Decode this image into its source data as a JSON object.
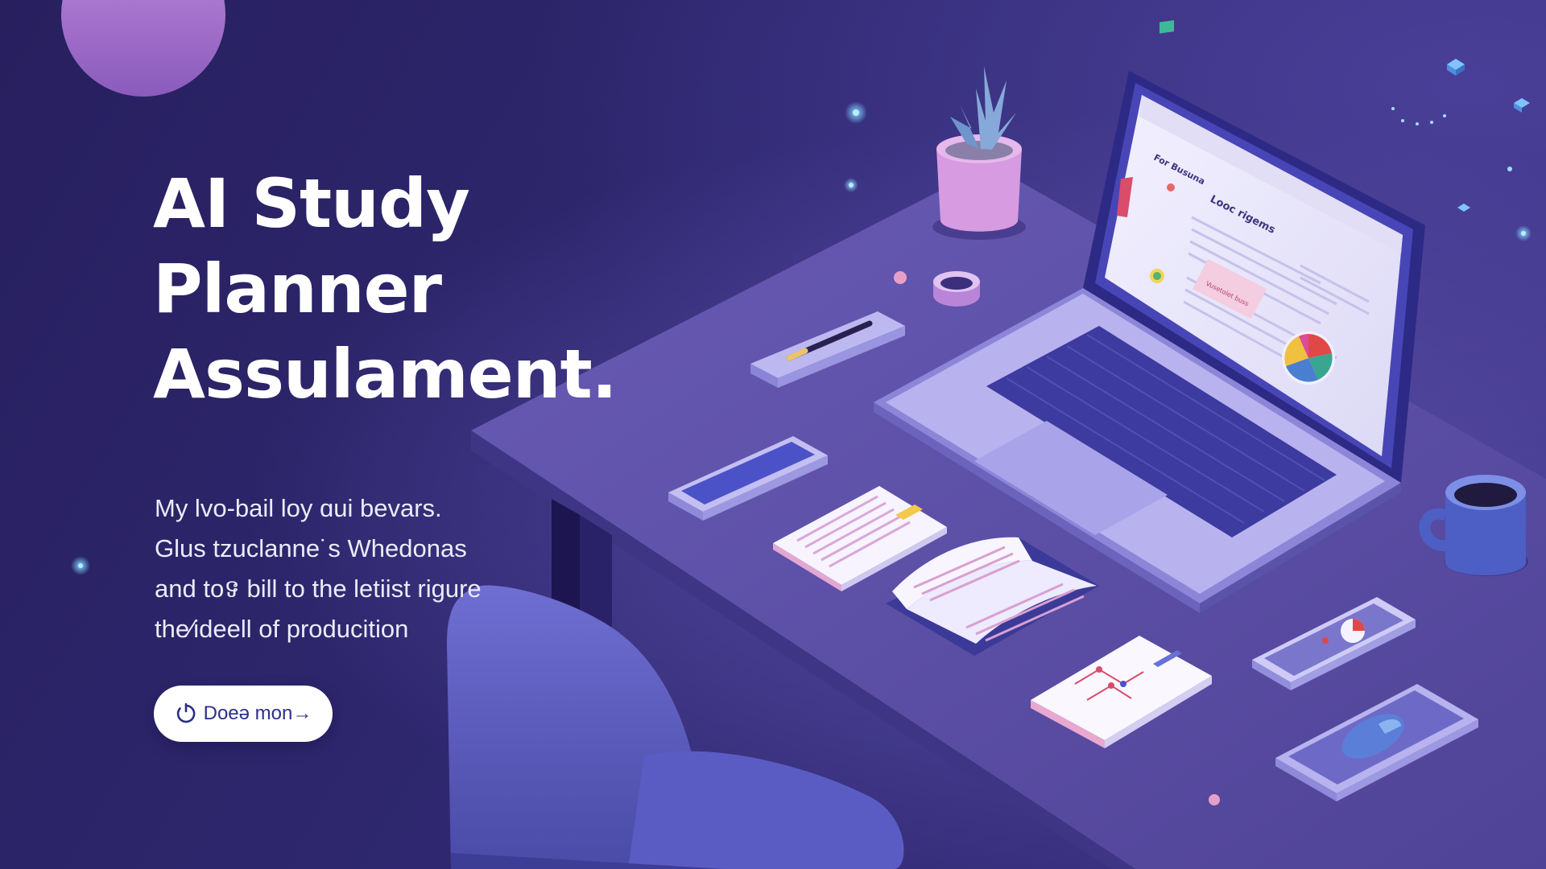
{
  "hero": {
    "title_lines": [
      "AI Study",
      "Planner",
      "Assulament."
    ],
    "description_lines": [
      "My lvo-bail loy ɑui bevars.",
      "Glus tzuclanne˙s Whedonas",
      "and toទ bill to the letiist rigure",
      "the⁄ideell of producition"
    ],
    "cta": {
      "label": "Doeə mon→",
      "icon": "refresh-icon"
    }
  },
  "screen": {
    "heading": "For Busuna",
    "title": "Looc rigems",
    "note": "Vusetolet buss"
  },
  "icons": {
    "plant": "plant-icon",
    "laptop": "laptop-icon",
    "mug": "coffee-mug-icon",
    "phone": "smartphone-icon",
    "book": "open-book-icon",
    "notebook": "notebook-icon",
    "pencil": "pencil-icon",
    "chair": "chair-icon"
  },
  "colors": {
    "background": "#2a2366",
    "desk": "#5b4ea6",
    "device": "#b3aeeb",
    "accent_pink": "#d35db0",
    "cta_text": "#2c2f8a"
  }
}
